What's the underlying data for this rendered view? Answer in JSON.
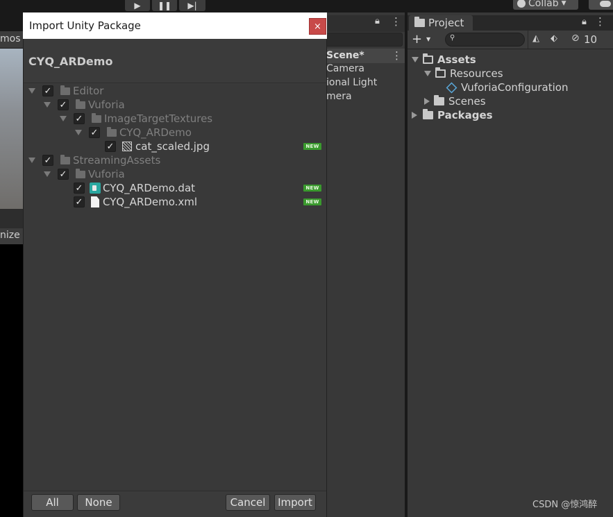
{
  "toolbar": {
    "collab_label": "Collab"
  },
  "left_panel": {
    "tab_text": "mos",
    "tab2_text": "nize"
  },
  "hierarchy": {
    "scene_row": "Scene*",
    "items": [
      "Camera",
      "ional Light",
      "mera"
    ]
  },
  "project": {
    "tab_label": "Project",
    "hidden_count": "10",
    "tree": [
      {
        "label": "Assets",
        "expanded": true,
        "bold": true
      },
      {
        "label": "Resources",
        "expanded": true,
        "bold": false
      },
      {
        "label": "VuforiaConfiguration",
        "bold": false
      },
      {
        "label": "Scenes",
        "expanded": false,
        "bold": false
      },
      {
        "label": "Packages",
        "expanded": false,
        "bold": true
      }
    ]
  },
  "dialog": {
    "title": "Import Unity Package",
    "close_glyph": "×",
    "package_name": "CYQ_ARDemo",
    "tree": [
      {
        "label": "Editor",
        "type": "folder",
        "new": false
      },
      {
        "label": "Vuforia",
        "type": "folder",
        "new": false
      },
      {
        "label": "ImageTargetTextures",
        "type": "folder",
        "new": false
      },
      {
        "label": "CYQ_ARDemo",
        "type": "folder",
        "new": false
      },
      {
        "label": "cat_scaled.jpg",
        "type": "image",
        "new": true
      },
      {
        "label": "StreamingAssets",
        "type": "folder",
        "new": false
      },
      {
        "label": "Vuforia",
        "type": "folder",
        "new": false
      },
      {
        "label": "CYQ_ARDemo.dat",
        "type": "dat",
        "new": true
      },
      {
        "label": "CYQ_ARDemo.xml",
        "type": "doc",
        "new": true
      }
    ],
    "new_badge": "NEW",
    "buttons": {
      "all": "All",
      "none": "None",
      "cancel": "Cancel",
      "import": "Import"
    }
  },
  "watermark": "CSDN @惊鸿醉",
  "colors": {
    "close_button": "#c84a49",
    "new_badge": "#3a9a2e",
    "dat_icon": "#2aa7a0"
  }
}
